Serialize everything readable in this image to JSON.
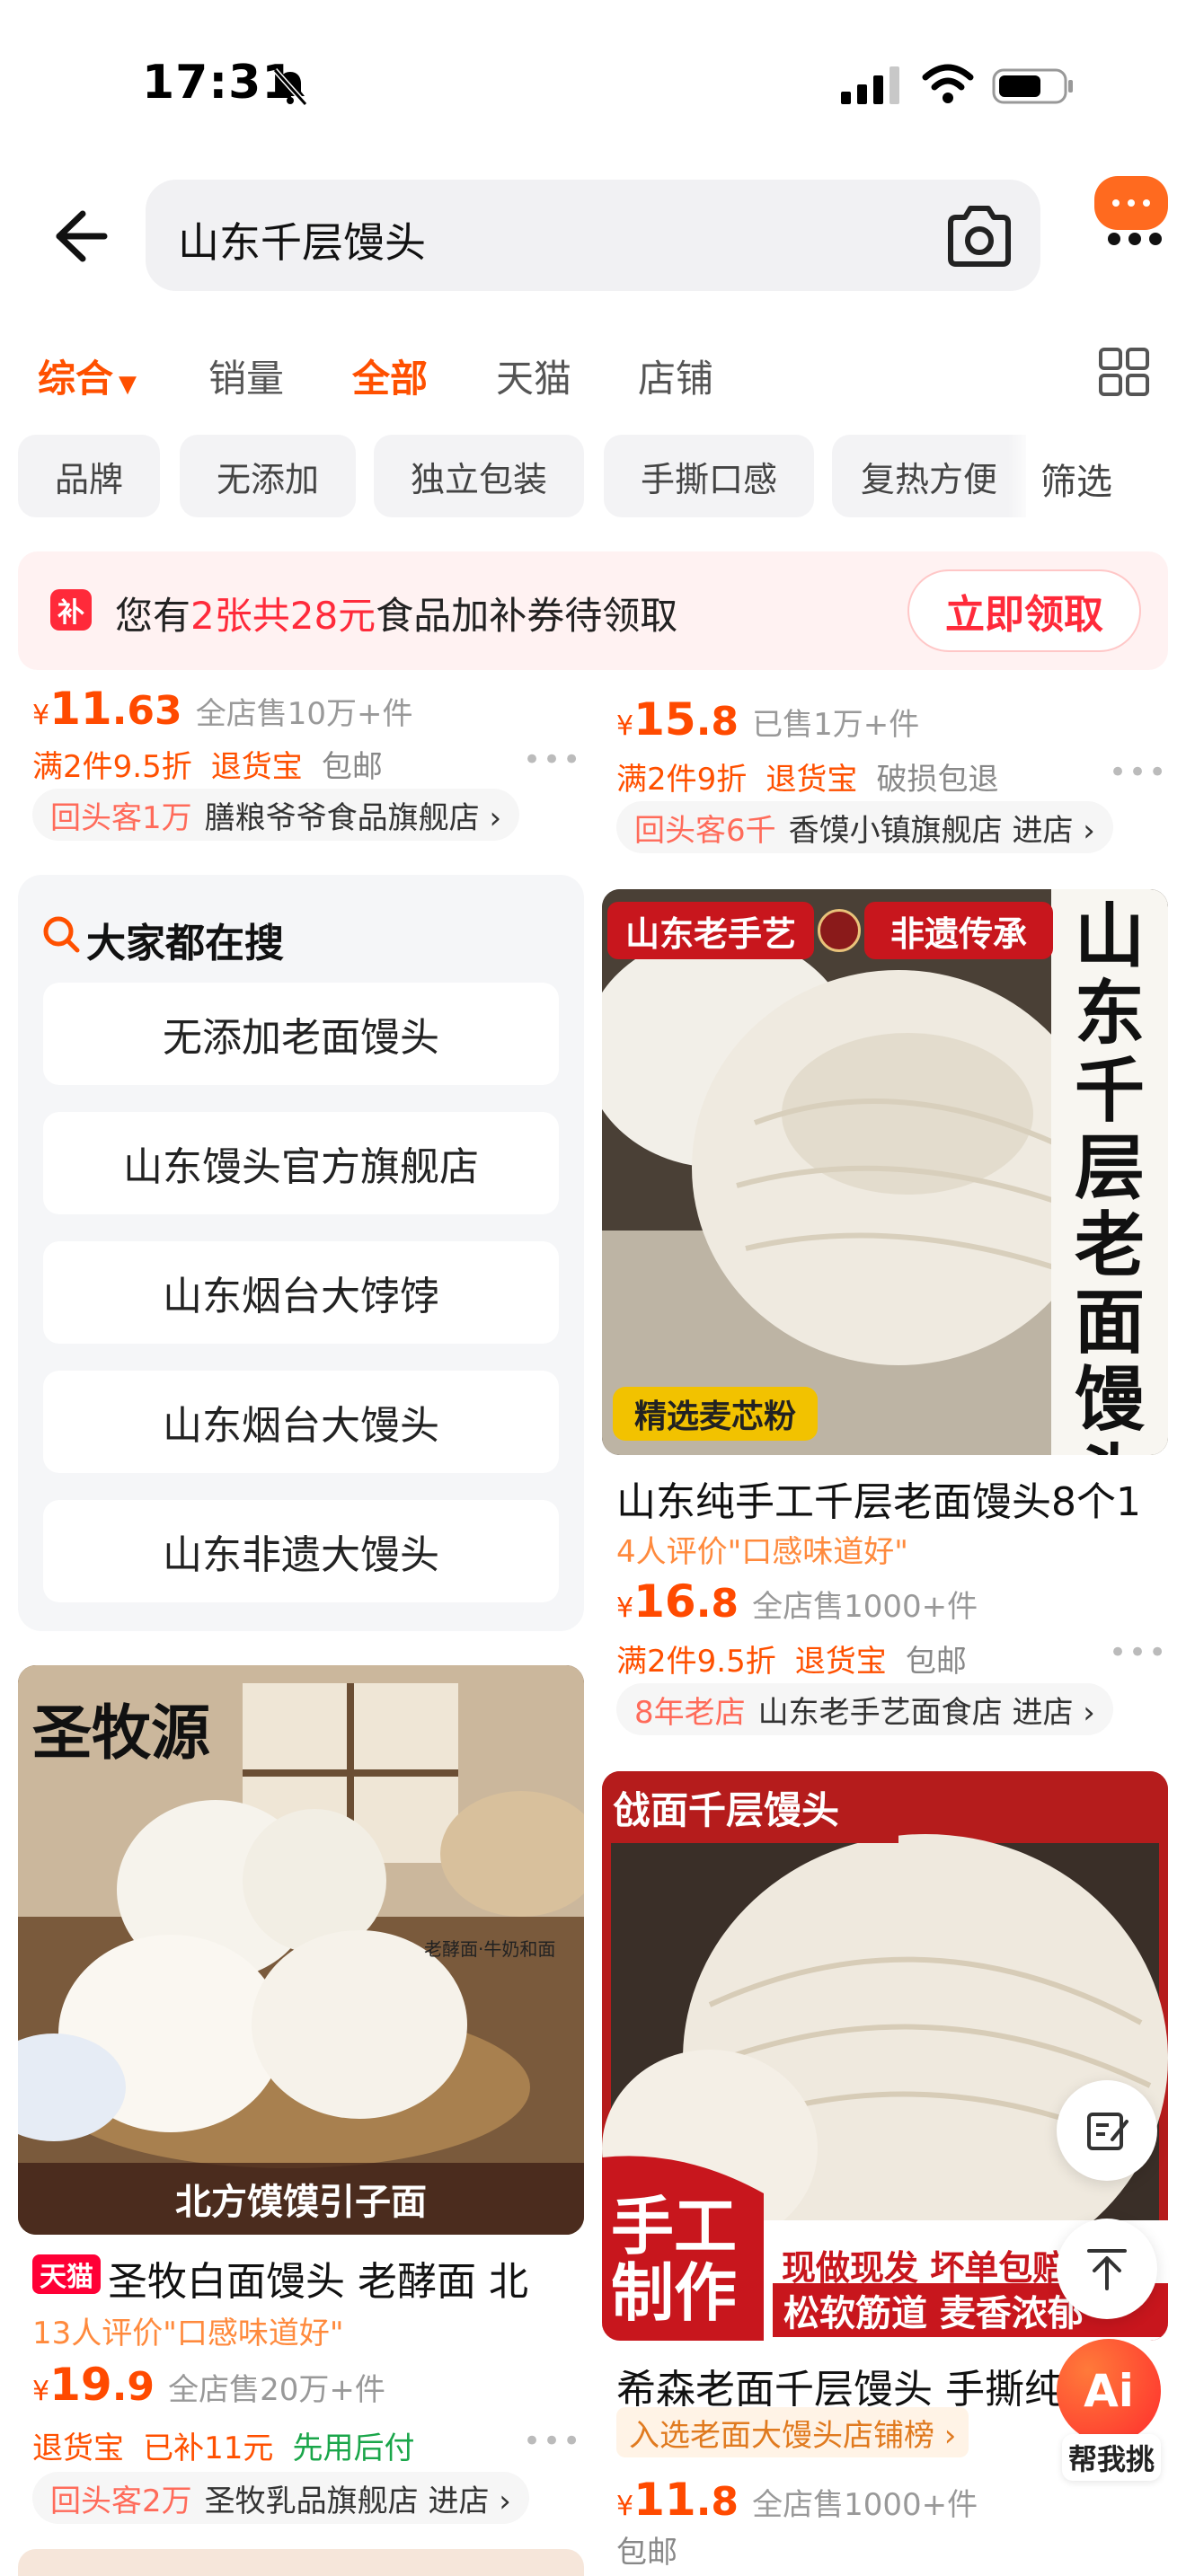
{
  "status": {
    "time": "17:31"
  },
  "search": {
    "query": "山东千层馒头"
  },
  "tabs": [
    {
      "label": "综合",
      "active": true
    },
    {
      "label": "销量",
      "active": false
    },
    {
      "label": "全部",
      "active": true
    },
    {
      "label": "天猫",
      "active": false
    },
    {
      "label": "店铺",
      "active": false
    }
  ],
  "chips": [
    "品牌",
    "无添加",
    "独立包装",
    "手撕口感",
    "复热方便"
  ],
  "filter_label": "筛选",
  "banner": {
    "icon_text": "补",
    "pre": "您有",
    "highlight": "2张共28元",
    "post": "食品加补券待领取",
    "button": "立即领取"
  },
  "products_top": [
    {
      "price_int": "11",
      "price_dec": ".63",
      "sold": "全店售10万+件",
      "promo1": "满2件9.5折",
      "promo2": "退货宝",
      "extra": "包邮",
      "shop_tag": "回头客1万",
      "shop_name": "膳粮爷爷食品旗舰店 ›"
    },
    {
      "price_int": "15",
      "price_dec": ".8",
      "sold": "已售1万+件",
      "promo1": "满2件9折",
      "promo2": "退货宝",
      "extra": "破损包退",
      "shop_tag": "回头客6千",
      "shop_name": "香馍小镇旗舰店 进店 ›"
    }
  ],
  "popular": {
    "title": "大家都在搜",
    "items": [
      "无添加老面馒头",
      "山东馒头官方旗舰店",
      "山东烟台大饽饽",
      "山东烟台大馒头",
      "山东非遗大馒头"
    ]
  },
  "product_right1": {
    "img_tag1": "山东老手艺",
    "img_tag2": "非遗传承",
    "img_vertical": "山东千层老面馒头",
    "img_badge": "精选麦芯粉",
    "title": "山东纯手工千层老面馒头8个1",
    "eval": "4人评价\"口感味道好\"",
    "price_int": "16",
    "price_dec": ".8",
    "sold": "全店售1000+件",
    "promo1": "满2件9.5折",
    "promo2": "退货宝",
    "extra": "包邮",
    "shop_tag": "8年老店",
    "shop_name": "山东老手艺面食店 进店 ›"
  },
  "product_left2": {
    "img_brand": "圣牧源",
    "img_small": "老酵面·牛奶和面",
    "img_bottom": "北方馍馍引子面",
    "tmall": "天猫",
    "title": "圣牧白面馒头 老酵面 北",
    "eval": "13人评价\"口感味道好\"",
    "price_int": "19",
    "price_dec": ".9",
    "sold": "全店售20万+件",
    "promo2": "退货宝",
    "promo3": "已补11元",
    "promo4": "先用后付",
    "shop_tag": "回头客2万",
    "shop_name": "圣牧乳品旗舰店 进店 ›"
  },
  "product_right2": {
    "img_top": "戗面千层馒头",
    "img_hand1": "手工",
    "img_hand2": "制作",
    "img_line1": "现做现发 坏单包赔",
    "img_line2": "松软筋道 麦香浓郁",
    "title": "希森老面千层馒头 手撕纯",
    "rank": "入选老面大馒头店铺榜 ›",
    "price_int": "11",
    "price_dec": ".8",
    "sold": "全店售1000+件",
    "extra": "包邮"
  },
  "ai": {
    "badge": "Ai",
    "label": "帮我挑"
  },
  "colors": {
    "accent": "#ff5000",
    "red": "#ff2a3a"
  },
  "icons": [
    "bell-off-icon",
    "signal-icon",
    "wifi-icon",
    "battery-icon",
    "back-arrow-icon",
    "camera-icon",
    "more-icon",
    "grid-view-icon",
    "search-icon",
    "edit-icon",
    "back-to-top-icon"
  ]
}
